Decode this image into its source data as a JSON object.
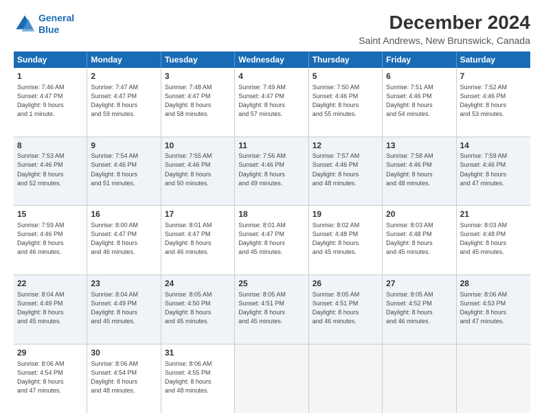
{
  "header": {
    "logo_line1": "General",
    "logo_line2": "Blue",
    "title": "December 2024",
    "subtitle": "Saint Andrews, New Brunswick, Canada"
  },
  "weekdays": [
    "Sunday",
    "Monday",
    "Tuesday",
    "Wednesday",
    "Thursday",
    "Friday",
    "Saturday"
  ],
  "rows": [
    [
      {
        "day": "1",
        "info": "Sunrise: 7:46 AM\nSunset: 4:47 PM\nDaylight: 9 hours\nand 1 minute."
      },
      {
        "day": "2",
        "info": "Sunrise: 7:47 AM\nSunset: 4:47 PM\nDaylight: 8 hours\nand 59 minutes."
      },
      {
        "day": "3",
        "info": "Sunrise: 7:48 AM\nSunset: 4:47 PM\nDaylight: 8 hours\nand 58 minutes."
      },
      {
        "day": "4",
        "info": "Sunrise: 7:49 AM\nSunset: 4:47 PM\nDaylight: 8 hours\nand 57 minutes."
      },
      {
        "day": "5",
        "info": "Sunrise: 7:50 AM\nSunset: 4:46 PM\nDaylight: 8 hours\nand 55 minutes."
      },
      {
        "day": "6",
        "info": "Sunrise: 7:51 AM\nSunset: 4:46 PM\nDaylight: 8 hours\nand 54 minutes."
      },
      {
        "day": "7",
        "info": "Sunrise: 7:52 AM\nSunset: 4:46 PM\nDaylight: 8 hours\nand 53 minutes."
      }
    ],
    [
      {
        "day": "8",
        "info": "Sunrise: 7:53 AM\nSunset: 4:46 PM\nDaylight: 8 hours\nand 52 minutes."
      },
      {
        "day": "9",
        "info": "Sunrise: 7:54 AM\nSunset: 4:46 PM\nDaylight: 8 hours\nand 51 minutes."
      },
      {
        "day": "10",
        "info": "Sunrise: 7:55 AM\nSunset: 4:46 PM\nDaylight: 8 hours\nand 50 minutes."
      },
      {
        "day": "11",
        "info": "Sunrise: 7:56 AM\nSunset: 4:46 PM\nDaylight: 8 hours\nand 49 minutes."
      },
      {
        "day": "12",
        "info": "Sunrise: 7:57 AM\nSunset: 4:46 PM\nDaylight: 8 hours\nand 48 minutes."
      },
      {
        "day": "13",
        "info": "Sunrise: 7:58 AM\nSunset: 4:46 PM\nDaylight: 8 hours\nand 48 minutes."
      },
      {
        "day": "14",
        "info": "Sunrise: 7:59 AM\nSunset: 4:46 PM\nDaylight: 8 hours\nand 47 minutes."
      }
    ],
    [
      {
        "day": "15",
        "info": "Sunrise: 7:59 AM\nSunset: 4:46 PM\nDaylight: 8 hours\nand 46 minutes."
      },
      {
        "day": "16",
        "info": "Sunrise: 8:00 AM\nSunset: 4:47 PM\nDaylight: 8 hours\nand 46 minutes."
      },
      {
        "day": "17",
        "info": "Sunrise: 8:01 AM\nSunset: 4:47 PM\nDaylight: 8 hours\nand 46 minutes."
      },
      {
        "day": "18",
        "info": "Sunrise: 8:01 AM\nSunset: 4:47 PM\nDaylight: 8 hours\nand 45 minutes."
      },
      {
        "day": "19",
        "info": "Sunrise: 8:02 AM\nSunset: 4:48 PM\nDaylight: 8 hours\nand 45 minutes."
      },
      {
        "day": "20",
        "info": "Sunrise: 8:03 AM\nSunset: 4:48 PM\nDaylight: 8 hours\nand 45 minutes."
      },
      {
        "day": "21",
        "info": "Sunrise: 8:03 AM\nSunset: 4:48 PM\nDaylight: 8 hours\nand 45 minutes."
      }
    ],
    [
      {
        "day": "22",
        "info": "Sunrise: 8:04 AM\nSunset: 4:49 PM\nDaylight: 8 hours\nand 45 minutes."
      },
      {
        "day": "23",
        "info": "Sunrise: 8:04 AM\nSunset: 4:49 PM\nDaylight: 8 hours\nand 45 minutes."
      },
      {
        "day": "24",
        "info": "Sunrise: 8:05 AM\nSunset: 4:50 PM\nDaylight: 8 hours\nand 45 minutes."
      },
      {
        "day": "25",
        "info": "Sunrise: 8:05 AM\nSunset: 4:51 PM\nDaylight: 8 hours\nand 45 minutes."
      },
      {
        "day": "26",
        "info": "Sunrise: 8:05 AM\nSunset: 4:51 PM\nDaylight: 8 hours\nand 46 minutes."
      },
      {
        "day": "27",
        "info": "Sunrise: 8:05 AM\nSunset: 4:52 PM\nDaylight: 8 hours\nand 46 minutes."
      },
      {
        "day": "28",
        "info": "Sunrise: 8:06 AM\nSunset: 4:53 PM\nDaylight: 8 hours\nand 47 minutes."
      }
    ],
    [
      {
        "day": "29",
        "info": "Sunrise: 8:06 AM\nSunset: 4:54 PM\nDaylight: 8 hours\nand 47 minutes."
      },
      {
        "day": "30",
        "info": "Sunrise: 8:06 AM\nSunset: 4:54 PM\nDaylight: 8 hours\nand 48 minutes."
      },
      {
        "day": "31",
        "info": "Sunrise: 8:06 AM\nSunset: 4:55 PM\nDaylight: 8 hours\nand 48 minutes."
      },
      {
        "day": "",
        "info": ""
      },
      {
        "day": "",
        "info": ""
      },
      {
        "day": "",
        "info": ""
      },
      {
        "day": "",
        "info": ""
      }
    ]
  ]
}
